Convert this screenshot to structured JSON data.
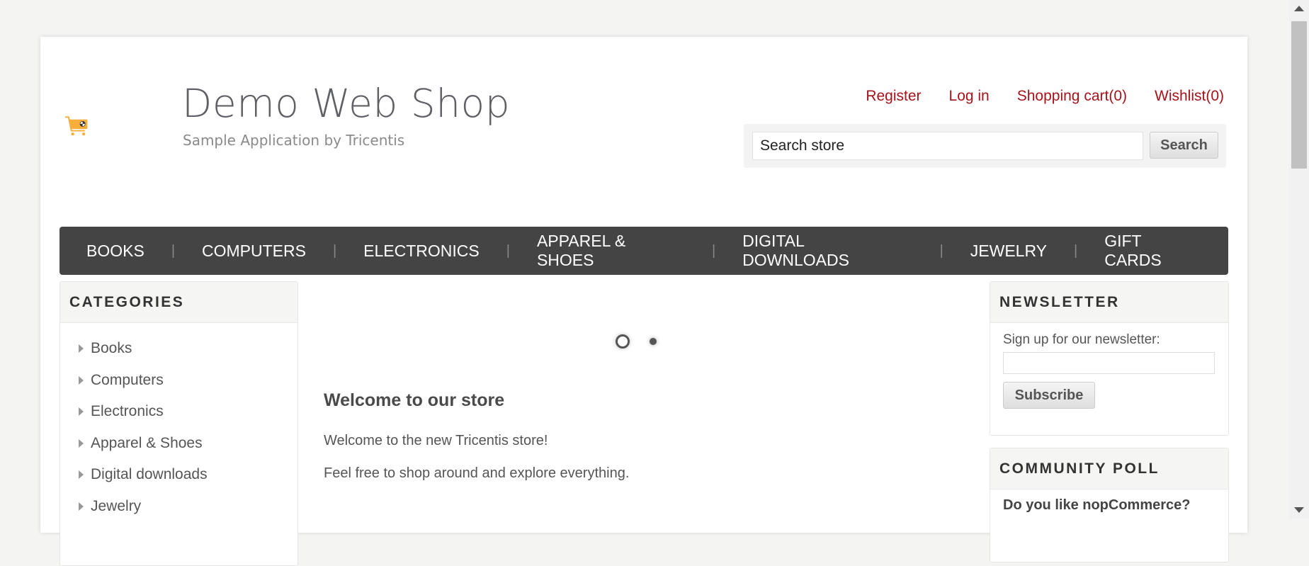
{
  "header": {
    "logo_title": "Demo Web Shop",
    "logo_subtitle": "Sample Application by Tricentis",
    "links": {
      "register": "Register",
      "login": "Log in",
      "cart": "Shopping cart(0)",
      "wishlist": "Wishlist(0)"
    },
    "search": {
      "value": "Search store",
      "button": "Search"
    }
  },
  "topmenu": [
    "BOOKS",
    "COMPUTERS",
    "ELECTRONICS",
    "APPAREL & SHOES",
    "DIGITAL DOWNLOADS",
    "JEWELRY",
    "GIFT CARDS"
  ],
  "categories": {
    "title": "CATEGORIES",
    "items": [
      "Books",
      "Computers",
      "Electronics",
      "Apparel & Shoes",
      "Digital downloads",
      "Jewelry"
    ]
  },
  "main": {
    "welcome_title": "Welcome to our store",
    "p1": "Welcome to the new Tricentis store!",
    "p2": "Feel free to shop around and explore everything."
  },
  "newsletter": {
    "title": "NEWSLETTER",
    "label": "Sign up for our newsletter:",
    "button": "Subscribe"
  },
  "poll": {
    "title": "COMMUNITY POLL",
    "question": "Do you like nopCommerce?"
  },
  "colors": {
    "link": "#a8121a",
    "menu_bg": "#444444",
    "logo_orange": "#f9ae3b"
  }
}
